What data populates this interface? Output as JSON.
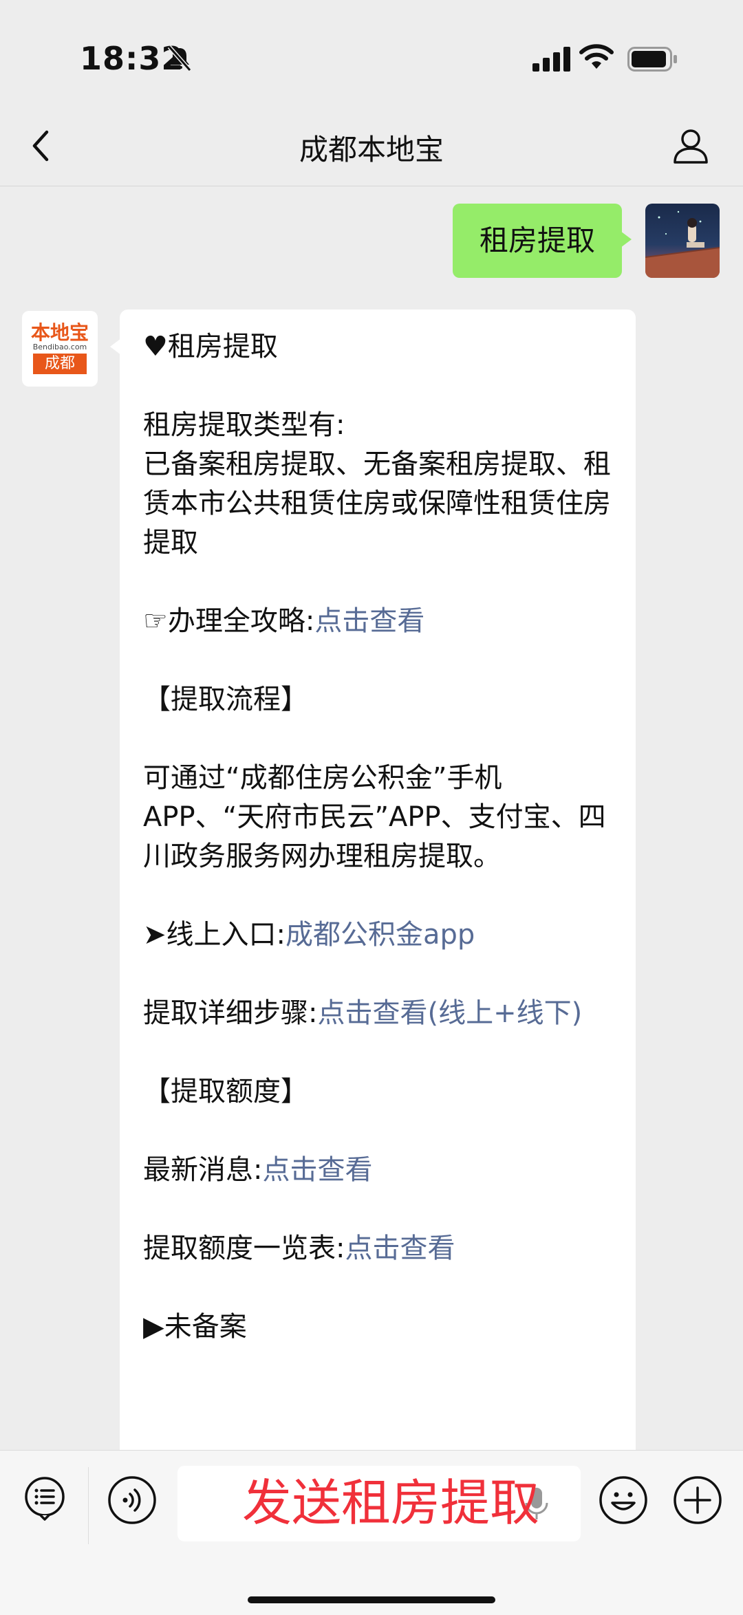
{
  "status_bar": {
    "time": "18:32",
    "icons": [
      "bell-mute-icon",
      "signal-icon",
      "wifi-icon",
      "battery-icon"
    ]
  },
  "nav": {
    "title": "成都本地宝",
    "back_icon": "chevron-left-icon",
    "profile_icon": "person-icon"
  },
  "sent_message": {
    "text": "租房提取"
  },
  "bot": {
    "logo_top": "本地宝",
    "logo_mid": "Bendibao.com",
    "logo_bottom": "成都"
  },
  "received_message": {
    "heading": "♥租房提取",
    "types_label": "租房提取类型有:",
    "types_text": "已备案租房提取、无备案租房提取、租赁本市公共租赁住房或保障性租赁住房提取",
    "guide_label": "☞办理全攻略:",
    "guide_link": "点击查看",
    "process_heading": "【提取流程】",
    "process_text": "可通过“成都住房公积金”手机APP、“天府市民云”APP、支付宝、四川政务服务网办理租房提取。",
    "online_label": "➤线上入口:",
    "online_link": "成都公积金app",
    "steps_label": "提取详细步骤:",
    "steps_link": "点击查看(线上+线下)",
    "amount_heading": "【提取额度】",
    "news_label": "最新消息:",
    "news_link": "点击查看",
    "table_label": "提取额度一览表:",
    "table_link": "点击查看",
    "unfiled_label": "▶未备案"
  },
  "input_bar": {
    "overlay_text": "发送租房提取",
    "icons": [
      "list-icon",
      "voice-icon",
      "mic-icon",
      "emoji-icon",
      "plus-icon"
    ]
  },
  "colors": {
    "sent_bubble": "#95ec69",
    "link": "#576b95",
    "overlay_text": "#f0303a",
    "brand_orange": "#e8571a"
  }
}
